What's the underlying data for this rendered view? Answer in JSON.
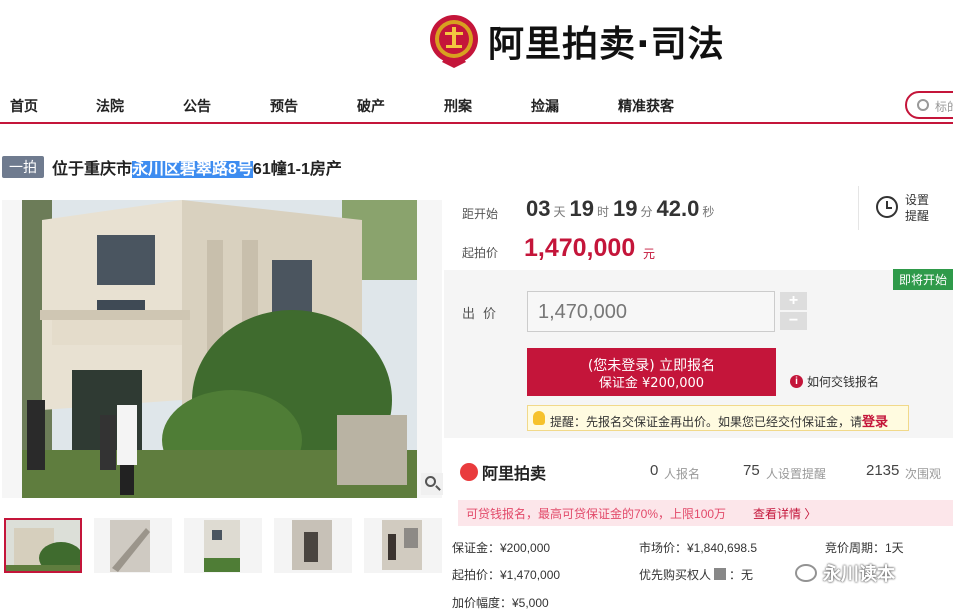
{
  "header": {
    "brand": "阿里拍卖·司法"
  },
  "nav": {
    "items": [
      "首页",
      "法院",
      "公告",
      "预告",
      "破产",
      "刑案",
      "捡漏",
      "精准获客"
    ],
    "search_placeholder": "标的"
  },
  "listing": {
    "badge": "一拍",
    "title_prefix": "位于重庆市",
    "title_highlight": "永川区碧翠路8号",
    "title_suffix": "61幢1-1房产"
  },
  "countdown": {
    "label": "距开始",
    "days": "03",
    "days_unit": "天",
    "hours": "19",
    "hours_unit": "时",
    "minutes": "19",
    "minutes_unit": "分",
    "seconds": "42.0",
    "seconds_unit": "秒",
    "remind_label": "设置提醒"
  },
  "price": {
    "label": "起拍价",
    "value": "1,470,000",
    "unit": "元"
  },
  "bid": {
    "status_badge": "即将开始",
    "label": "出价",
    "value": "1,470,000",
    "plus": "+",
    "minus": "−",
    "signup_line1": "(您未登录) 立即报名",
    "signup_line2": "保证金 ¥200,000",
    "how_pay": "如何交钱报名",
    "tip_text": "提醒：先报名交保证金再出价。如果您已经交付保证金，请",
    "tip_link": "登录"
  },
  "stats": {
    "brand": "阿里拍卖",
    "signups": "0",
    "signups_label": "人报名",
    "reminders": "75",
    "reminders_label": "人设置提醒",
    "views": "2135",
    "views_label": "次围观"
  },
  "loan": {
    "text": "可贷钱报名，最高可贷保证金的70%，上限100万",
    "link": "查看详情 〉"
  },
  "details": {
    "deposit": "保证金：¥200,000",
    "market_price": "市场价：¥1,840,698.5",
    "period": "竞价周期：1天",
    "start_price": "起拍价：¥1,470,000",
    "priority": "优先购买权人",
    "priority_value": "：无",
    "increment": "加价幅度：¥5,000"
  },
  "watermark": {
    "text": "永川读本"
  }
}
